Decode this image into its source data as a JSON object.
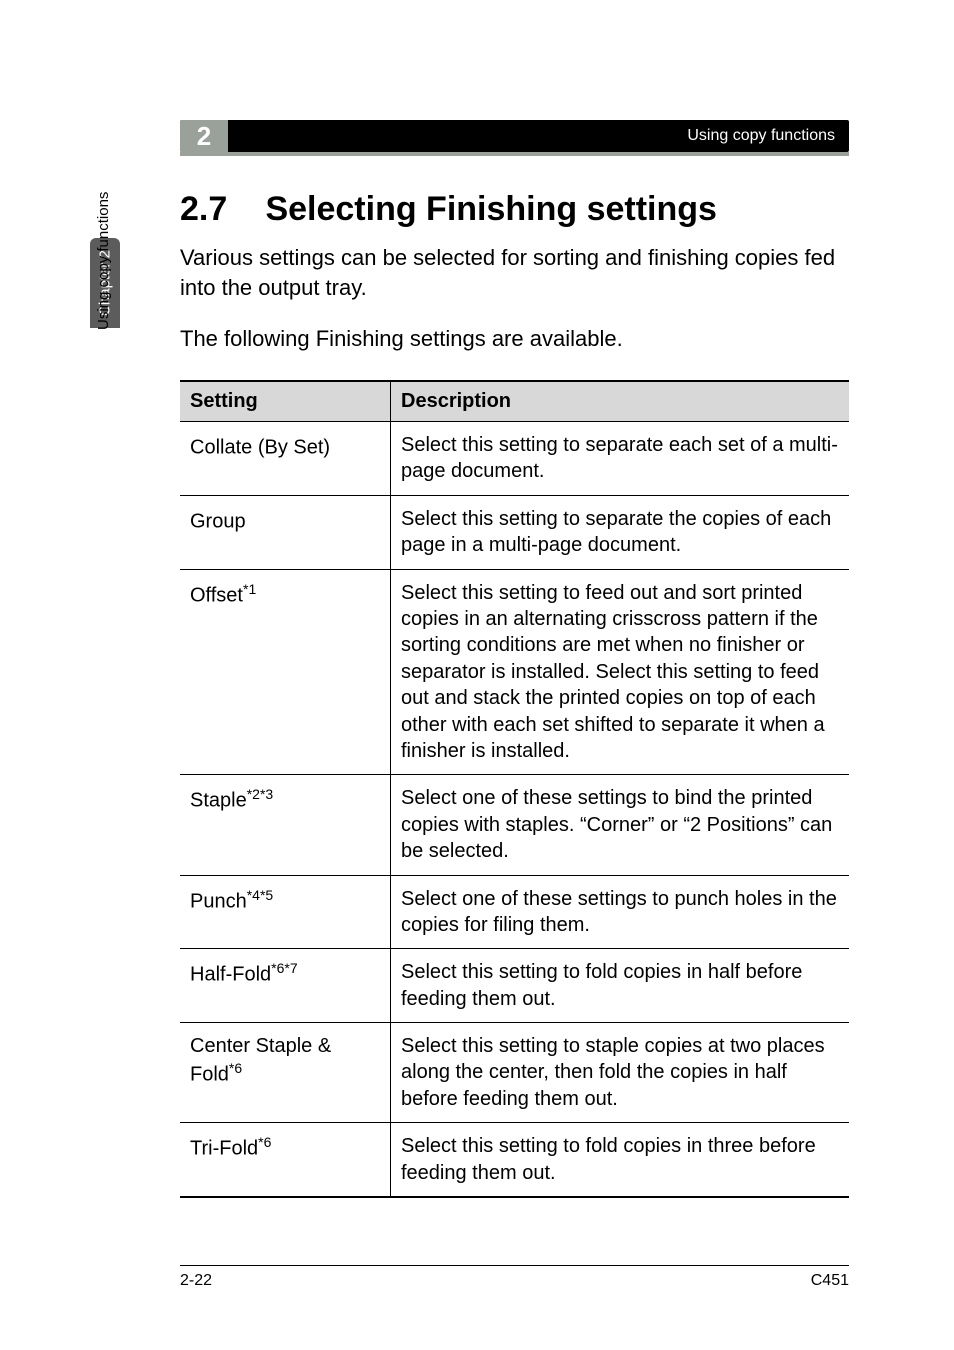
{
  "sideTab": {
    "chapter": "Chapter 2",
    "label": "Using copy functions"
  },
  "header": {
    "badgeNumber": "2",
    "runningTitle": "Using copy functions"
  },
  "section": {
    "number": "2.7",
    "title": "Selecting Finishing settings"
  },
  "intro": {
    "p1": "Various settings can be selected for sorting and finishing copies fed into the output tray.",
    "p2": "The following Finishing settings are available."
  },
  "table": {
    "headers": {
      "setting": "Setting",
      "description": "Description"
    },
    "rows": [
      {
        "name": "Collate (By Set)",
        "sup": "",
        "desc": "Select this setting to separate each set of a multi-page document."
      },
      {
        "name": "Group",
        "sup": "",
        "desc": "Select this setting to separate the copies of each page in a multi-page document."
      },
      {
        "name": "Offset",
        "sup": "*1",
        "desc": "Select this setting to feed out and sort printed copies in an alternating crisscross pattern if the sorting conditions are met when no finisher or separator is installed. Select this setting to feed out and stack the printed copies on top of each other with each set shifted to separate it when a finisher is installed."
      },
      {
        "name": "Staple",
        "sup": "*2*3",
        "desc": "Select one of these settings to bind the printed copies with staples. “Corner” or “2 Positions” can be selected."
      },
      {
        "name": "Punch",
        "sup": "*4*5",
        "desc": "Select one of these settings to punch holes in the copies for filing them."
      },
      {
        "name": "Half-Fold",
        "sup": "*6*7",
        "desc": "Select this setting to fold copies in half before feeding them out."
      },
      {
        "name": "Center Staple & Fold",
        "sup": "*6",
        "desc": "Select this setting to staple copies at two places along the center, then fold the copies in half before feeding them out."
      },
      {
        "name": "Tri-Fold",
        "sup": "*6",
        "desc": "Select this setting to fold copies in three before feeding them out."
      }
    ]
  },
  "footer": {
    "pageRef": "2-22",
    "model": "C451"
  }
}
